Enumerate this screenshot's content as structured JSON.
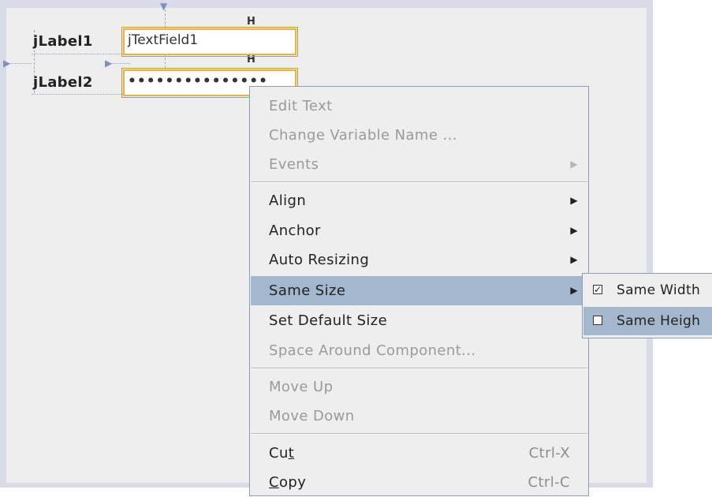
{
  "form": {
    "label1": "jLabel1",
    "label2": "jLabel2",
    "textfield1": "jTextField1",
    "password_mask": "•••••••••••••••"
  },
  "context_menu": {
    "items": [
      {
        "label": "Edit Text",
        "enabled": false
      },
      {
        "label": "Change Variable Name ...",
        "enabled": false
      },
      {
        "label": "Events",
        "enabled": false,
        "submenu": true
      },
      {
        "label": "Align",
        "enabled": true,
        "submenu": true
      },
      {
        "label": "Anchor",
        "enabled": true,
        "submenu": true
      },
      {
        "label": "Auto Resizing",
        "enabled": true,
        "submenu": true
      },
      {
        "label": "Same Size",
        "enabled": true,
        "submenu": true,
        "selected": true
      },
      {
        "label": "Set Default Size",
        "enabled": true
      },
      {
        "label": "Space Around Component...",
        "enabled": false
      },
      {
        "label": "Move Up",
        "enabled": false
      },
      {
        "label": "Move Down",
        "enabled": false
      },
      {
        "label": "Cut",
        "enabled": true,
        "shortcut": "Ctrl-X",
        "mnemonic": "t"
      },
      {
        "label": "Copy",
        "enabled": true,
        "shortcut": "Ctrl-C",
        "mnemonic": "C"
      }
    ]
  },
  "same_size_submenu": {
    "items": [
      {
        "label": "Same Width",
        "checked": true
      },
      {
        "label": "Same Heigh",
        "checked": false,
        "selected": true
      }
    ]
  },
  "colors": {
    "selection": "#a3b8cc",
    "component_border": "#e3b447",
    "menu_border": "#8e9bb9"
  }
}
